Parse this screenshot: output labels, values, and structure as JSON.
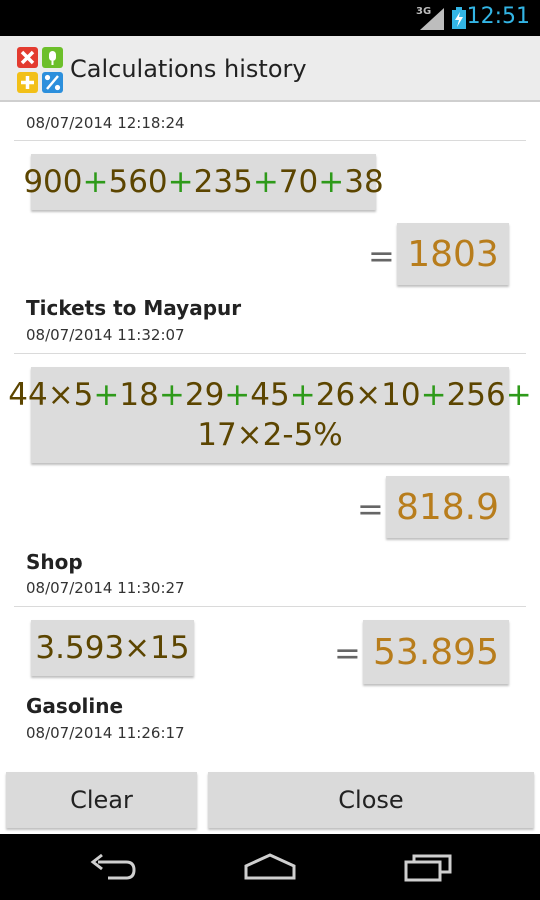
{
  "status": {
    "network": "3G",
    "time": "12:51"
  },
  "header": {
    "title": "Calculations history"
  },
  "entries": [
    {
      "date": "08/07/2014 12:18:24"
    },
    {
      "expression_parts": [
        {
          "t": "900",
          "c": "n"
        },
        {
          "t": "+",
          "c": "o"
        },
        {
          "t": "560",
          "c": "n"
        },
        {
          "t": "+",
          "c": "o"
        },
        {
          "t": "235",
          "c": "n"
        },
        {
          "t": "+",
          "c": "o"
        },
        {
          "t": "70",
          "c": "n"
        },
        {
          "t": "+",
          "c": "o"
        },
        {
          "t": "38",
          "c": "n"
        }
      ],
      "result": "1803",
      "label": "Tickets to Mayapur",
      "date": "08/07/2014 11:32:07"
    },
    {
      "expression_parts": [
        {
          "t": "44×5",
          "c": "n"
        },
        {
          "t": "+",
          "c": "o"
        },
        {
          "t": "18",
          "c": "n"
        },
        {
          "t": "+",
          "c": "o"
        },
        {
          "t": "29",
          "c": "n"
        },
        {
          "t": "+",
          "c": "o"
        },
        {
          "t": "45",
          "c": "n"
        },
        {
          "t": "+",
          "c": "o"
        },
        {
          "t": "26×10",
          "c": "n"
        },
        {
          "t": "+",
          "c": "o"
        },
        {
          "t": "256",
          "c": "n"
        },
        {
          "t": "+",
          "c": "o"
        },
        {
          "t": "17×2-5%",
          "c": "n"
        }
      ],
      "result": "818.9",
      "label": "Shop",
      "date": "08/07/2014 11:30:27"
    },
    {
      "expression_parts": [
        {
          "t": "3.593×15",
          "c": "n"
        }
      ],
      "result": "53.895",
      "label": "Gasoline",
      "date": "08/07/2014 11:26:17"
    }
  ],
  "equals_sign": "=",
  "buttons": {
    "clear": "Clear",
    "close": "Close"
  },
  "colors": {
    "operand": "#5c4500",
    "operator": "#2e9a1a",
    "result": "#b87d1c",
    "clock": "#33b5e5"
  }
}
